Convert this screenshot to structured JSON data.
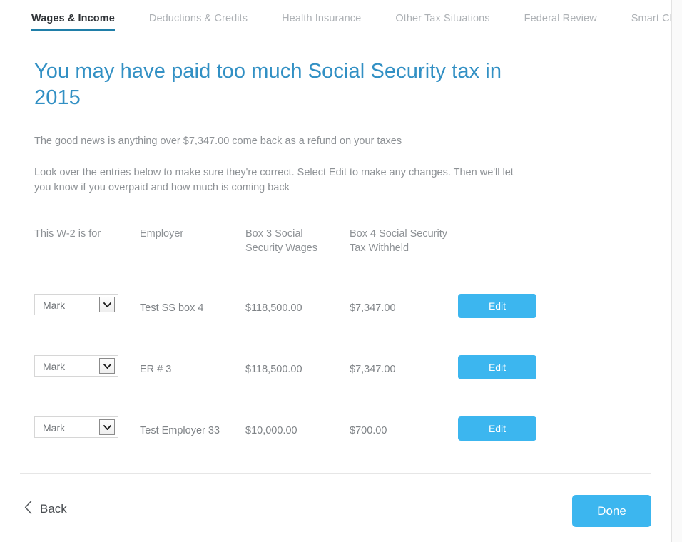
{
  "tabs": [
    {
      "label": "Wages & Income",
      "active": true
    },
    {
      "label": "Deductions & Credits",
      "active": false
    },
    {
      "label": "Health Insurance",
      "active": false
    },
    {
      "label": "Other Tax Situations",
      "active": false
    },
    {
      "label": "Federal Review",
      "active": false
    },
    {
      "label": "Smart Check",
      "active": false
    }
  ],
  "page": {
    "headline": "You may have paid too much Social Security tax in 2015",
    "lede": "The good news is anything over $7,347.00 come back as a refund on your taxes",
    "body": "Look over the entries below to make sure they're correct. Select Edit to make any changes. Then we'll let you know if you overpaid and how much is coming back"
  },
  "table": {
    "headers": {
      "who": "This W-2 is for",
      "employer": "Employer",
      "box3": "Box 3 Social Security Wages",
      "box4": "Box 4 Social Security Tax Withheld",
      "action": ""
    },
    "rows": [
      {
        "who": "Mark",
        "employer": "Test SS box 4",
        "box3": "$118,500.00",
        "box4": "$7,347.00",
        "edit_label": "Edit"
      },
      {
        "who": "Mark",
        "employer": "ER # 3",
        "box3": "$118,500.00",
        "box4": "$7,347.00",
        "edit_label": "Edit"
      },
      {
        "who": "Mark",
        "employer": "Test Employer 33",
        "box3": "$10,000.00",
        "box4": "$700.00",
        "edit_label": "Edit"
      }
    ],
    "who_options": [
      "Mark"
    ]
  },
  "footer": {
    "back_label": "Back",
    "done_label": "Done"
  },
  "colors": {
    "accent_blue": "#3cb6ef",
    "headline_blue": "#3290c4",
    "tab_underline": "#1f7ea8",
    "muted_text": "#8d9195",
    "active_tab_text": "#2e3236"
  },
  "icons": {
    "chevron_down": "chevron-down-icon",
    "chevron_left": "chevron-left-icon"
  }
}
